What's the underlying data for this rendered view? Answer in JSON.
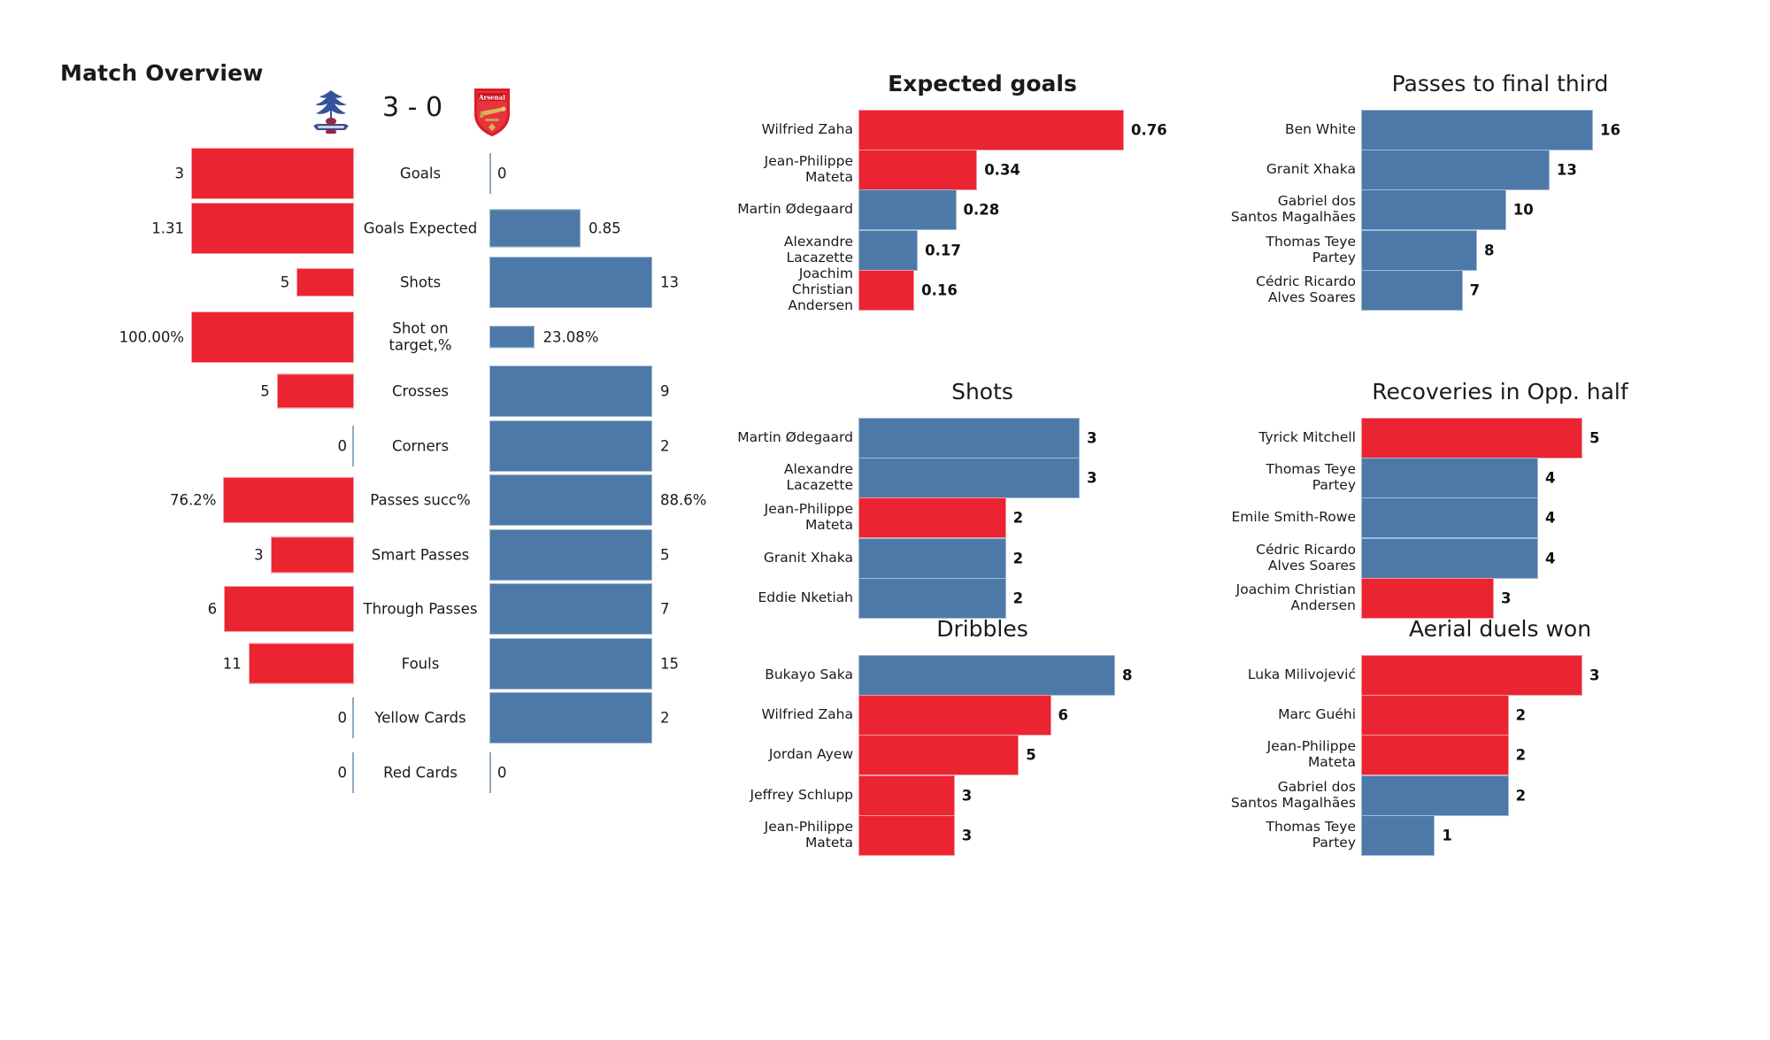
{
  "overview": {
    "title": "Match Overview",
    "score": "3 - 0",
    "home_team": "Crystal Palace",
    "away_team": "Arsenal",
    "home_color": "#ea2430",
    "away_color": "#4d79a8",
    "rows": [
      {
        "label": "Goals",
        "home": "3",
        "away": "0",
        "home_num": 3,
        "away_num": 0
      },
      {
        "label": "Goals Expected",
        "home": "1.31",
        "away": "0.85",
        "home_num": 1.31,
        "away_num": 0.85
      },
      {
        "label": "Shots",
        "home": "5",
        "away": "13",
        "home_num": 5,
        "away_num": 13
      },
      {
        "label": "Shot on\ntarget,%",
        "home": "100.00%",
        "away": "23.08%",
        "home_num": 100.0,
        "away_num": 23.08
      },
      {
        "label": "Crosses",
        "home": "5",
        "away": "9",
        "home_num": 5,
        "away_num": 9
      },
      {
        "label": "Corners",
        "home": "0",
        "away": "2",
        "home_num": 0,
        "away_num": 2
      },
      {
        "label": "Passes succ%",
        "home": "76.2%",
        "away": "88.6%",
        "home_num": 76.2,
        "away_num": 88.6
      },
      {
        "label": "Smart Passes",
        "home": "3",
        "away": "5",
        "home_num": 3,
        "away_num": 5
      },
      {
        "label": "Through Passes",
        "home": "6",
        "away": "7",
        "home_num": 6,
        "away_num": 7
      },
      {
        "label": "Fouls",
        "home": "11",
        "away": "15",
        "home_num": 11,
        "away_num": 15
      },
      {
        "label": "Yellow Cards",
        "home": "0",
        "away": "2",
        "home_num": 0,
        "away_num": 2
      },
      {
        "label": "Red Cards",
        "home": "0",
        "away": "0",
        "home_num": 0,
        "away_num": 0
      }
    ]
  },
  "chart_data": [
    {
      "type": "bar",
      "orientation": "horizontal",
      "title": "Expected goals",
      "title_bold": true,
      "xlabel": "",
      "ylabel": "",
      "categories": [
        "Wilfried Zaha",
        "Jean-Philippe Mateta",
        "Martin Ødegaard",
        "Alexandre Lacazette",
        "Joachim Christian Andersen"
      ],
      "values": [
        0.76,
        0.34,
        0.28,
        0.17,
        0.16
      ],
      "labels": [
        "0.76",
        "0.34",
        "0.28",
        "0.17",
        "0.16"
      ],
      "colors": [
        "red",
        "red",
        "blue",
        "blue",
        "red"
      ],
      "xlim": [
        0,
        0.76
      ]
    },
    {
      "type": "bar",
      "orientation": "horizontal",
      "title": "Passes to final third",
      "title_bold": false,
      "xlabel": "",
      "ylabel": "",
      "categories": [
        "Ben White",
        "Granit Xhaka",
        "Gabriel dos Santos Magalhães",
        "Thomas Teye Partey",
        "Cédric Ricardo Alves Soares"
      ],
      "values": [
        16,
        13,
        10,
        8,
        7
      ],
      "labels": [
        "16",
        "13",
        "10",
        "8",
        "7"
      ],
      "colors": [
        "blue",
        "blue",
        "blue",
        "blue",
        "blue"
      ],
      "xlim": [
        0,
        16
      ]
    },
    {
      "type": "bar",
      "orientation": "horizontal",
      "title": "Shots",
      "title_bold": false,
      "xlabel": "",
      "ylabel": "",
      "categories": [
        "Martin Ødegaard",
        "Alexandre Lacazette",
        "Jean-Philippe Mateta",
        "Granit Xhaka",
        "Eddie Nketiah"
      ],
      "values": [
        3,
        3,
        2,
        2,
        2
      ],
      "labels": [
        "3",
        "3",
        "2",
        "2",
        "2"
      ],
      "colors": [
        "blue",
        "blue",
        "red",
        "blue",
        "blue"
      ],
      "xlim": [
        0,
        3
      ]
    },
    {
      "type": "bar",
      "orientation": "horizontal",
      "title": "Recoveries in Opp. half",
      "title_bold": false,
      "xlabel": "",
      "ylabel": "",
      "categories": [
        "Tyrick Mitchell",
        "Thomas Teye Partey",
        "Emile Smith-Rowe",
        "Cédric Ricardo Alves Soares",
        "Joachim Christian Andersen"
      ],
      "values": [
        5,
        4,
        4,
        4,
        3
      ],
      "labels": [
        "5",
        "4",
        "4",
        "4",
        "3"
      ],
      "colors": [
        "red",
        "blue",
        "blue",
        "blue",
        "red"
      ],
      "xlim": [
        0,
        5
      ]
    },
    {
      "type": "bar",
      "orientation": "horizontal",
      "title": "Dribbles",
      "title_bold": false,
      "xlabel": "",
      "ylabel": "",
      "categories": [
        "Bukayo Saka",
        "Wilfried Zaha",
        "Jordan Ayew",
        "Jeffrey  Schlupp",
        "Jean-Philippe Mateta"
      ],
      "values": [
        8,
        6,
        5,
        3,
        3
      ],
      "labels": [
        "8",
        "6",
        "5",
        "3",
        "3"
      ],
      "colors": [
        "blue",
        "red",
        "red",
        "red",
        "red"
      ],
      "xlim": [
        0,
        8
      ]
    },
    {
      "type": "bar",
      "orientation": "horizontal",
      "title": "Aerial duels won",
      "title_bold": false,
      "xlabel": "",
      "ylabel": "",
      "categories": [
        "Luka Milivojević",
        "Marc Guéhi",
        "Jean-Philippe Mateta",
        "Gabriel dos Santos Magalhães",
        "Thomas Teye Partey"
      ],
      "values": [
        3,
        2,
        2,
        2,
        1
      ],
      "labels": [
        "3",
        "2",
        "2",
        "2",
        "1"
      ],
      "colors": [
        "red",
        "red",
        "red",
        "blue",
        "blue"
      ],
      "xlim": [
        0,
        3
      ]
    }
  ]
}
